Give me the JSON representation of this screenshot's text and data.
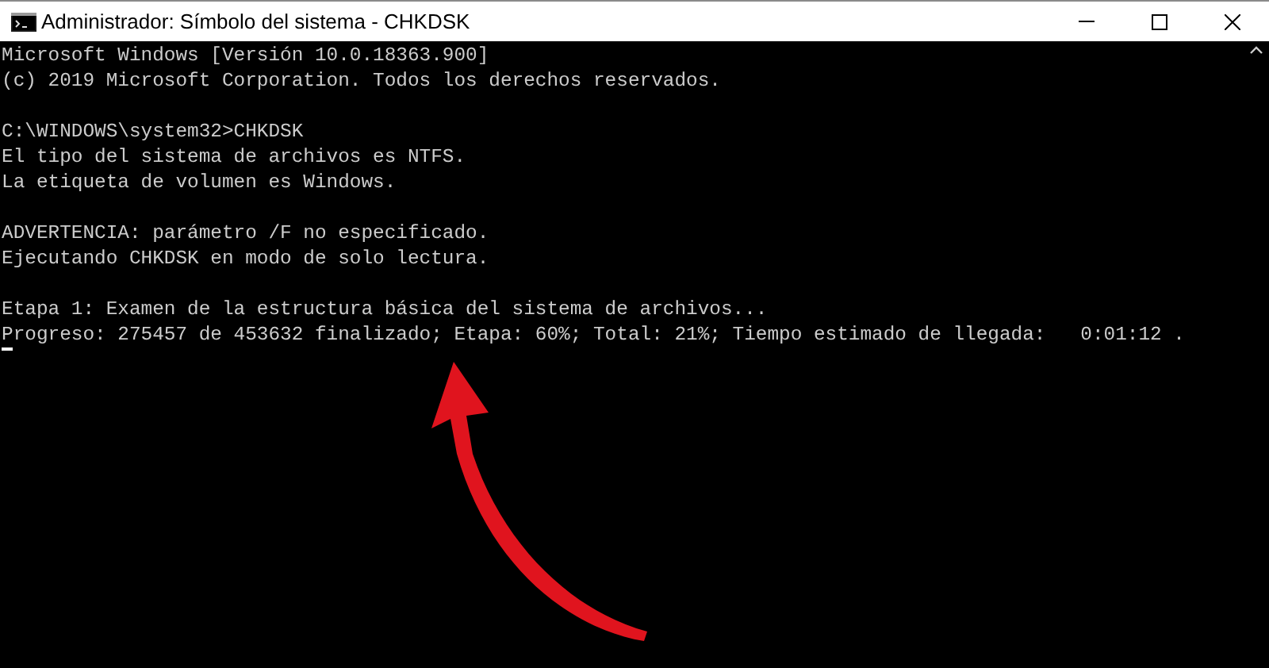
{
  "window": {
    "title": "Administrador: Símbolo del sistema - CHKDSK"
  },
  "console": {
    "blocks": [
      [
        "Microsoft Windows [Versión 10.0.18363.900]",
        "(c) 2019 Microsoft Corporation. Todos los derechos reservados."
      ],
      [
        "C:\\WINDOWS\\system32>CHKDSK",
        "El tipo del sistema de archivos es NTFS.",
        "La etiqueta de volumen es Windows."
      ],
      [
        "ADVERTENCIA: parámetro /F no especificado.",
        "Ejecutando CHKDSK en modo de solo lectura."
      ],
      [
        "Etapa 1: Examen de la estructura básica del sistema de archivos...",
        "Progreso: 275457 de 453632 finalizado; Etapa: 60%; Total: 21%; Tiempo estimado de llegada:   0:01:12 ."
      ]
    ]
  }
}
